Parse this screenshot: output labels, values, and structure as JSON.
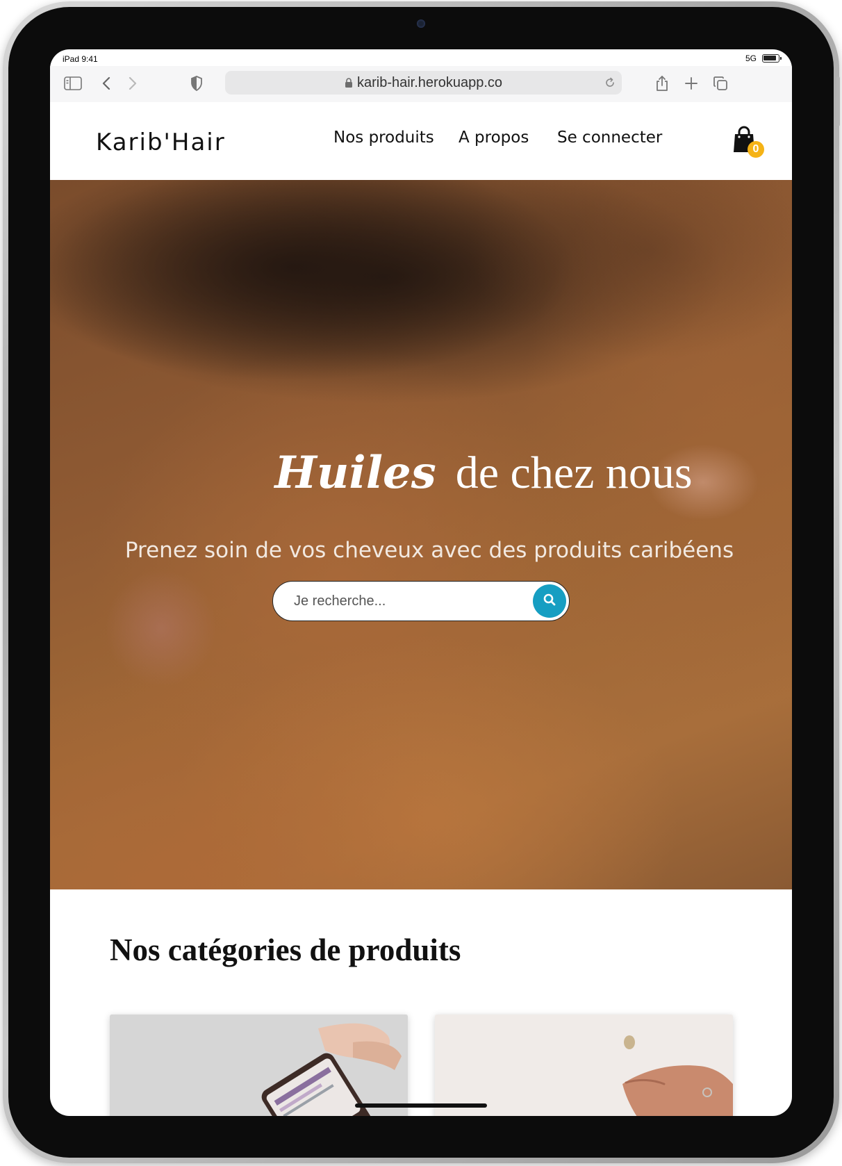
{
  "statusbar": {
    "left": "iPad 9:41",
    "network": "5G"
  },
  "browser": {
    "url": "karib-hair.herokuapp.co"
  },
  "site": {
    "logo": "Karib'Hair",
    "nav": [
      {
        "label": "Nos produits"
      },
      {
        "label": "A propos"
      },
      {
        "label": "Se connecter"
      }
    ],
    "cart_count": "0"
  },
  "hero": {
    "title_accent": "Huiles",
    "title_rest": "de chez nous",
    "subtitle": "Prenez soin de vos cheveux avec des produits caribéens",
    "search_placeholder": "Je recherche..."
  },
  "categories": {
    "title": "Nos catégories de produits"
  },
  "colors": {
    "accent": "#169ec2",
    "badge": "#f5b316"
  }
}
